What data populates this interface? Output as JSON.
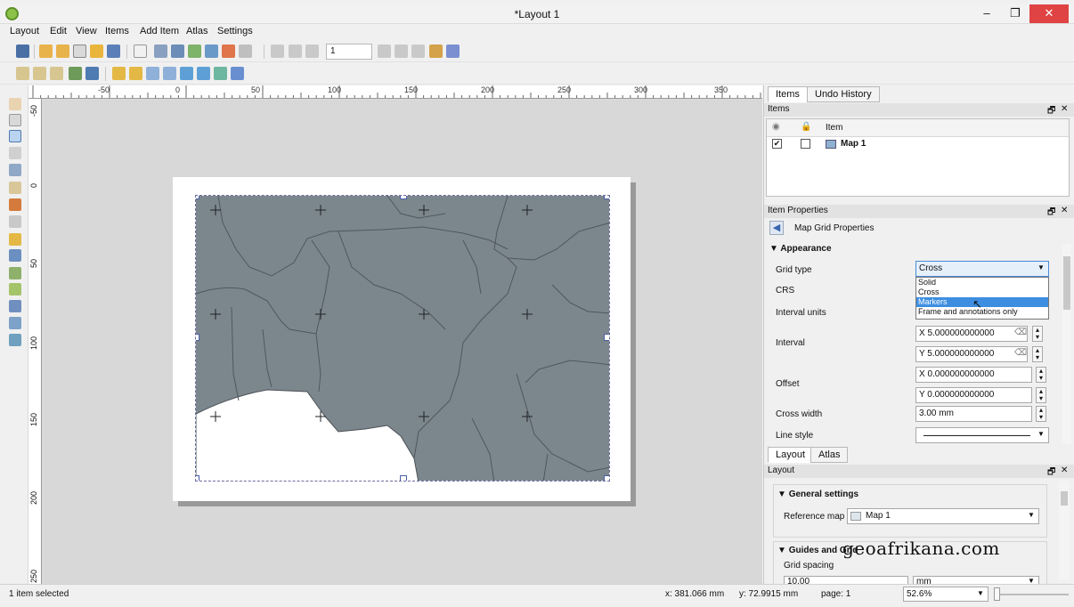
{
  "window": {
    "title": "*Layout 1",
    "min": "–",
    "max": "❐",
    "close": "✕"
  },
  "menu": [
    "Layout",
    "Edit",
    "View",
    "Items",
    "Add Item",
    "Atlas",
    "Settings"
  ],
  "toolbar": {
    "page_number": "1"
  },
  "ruler": {
    "top": [
      "-50",
      "0",
      "50",
      "100",
      "150",
      "200",
      "250",
      "300",
      "350"
    ],
    "left": [
      "-50",
      "0",
      "50",
      "100",
      "150",
      "200",
      "250"
    ]
  },
  "items_panel": {
    "tabs": [
      "Items",
      "Undo History"
    ],
    "header": "Items",
    "col_item": "Item",
    "rows": [
      {
        "name": "Map 1",
        "visible": true,
        "locked": false
      }
    ]
  },
  "item_props": {
    "header": "Item Properties",
    "subtitle": "Map Grid Properties",
    "section": "Appearance",
    "labels": {
      "grid_type": "Grid type",
      "crs": "CRS",
      "interval_units": "Interval units",
      "interval": "Interval",
      "offset": "Offset",
      "cross_width": "Cross width",
      "line_style": "Line style"
    },
    "grid_type_value": "Cross",
    "grid_type_options": [
      "Solid",
      "Cross",
      "Markers",
      "Frame and annotations only"
    ],
    "highlighted_option": "Markers",
    "interval_x": "X 5.000000000000",
    "interval_y": "Y 5.000000000000",
    "offset_x": "X 0.000000000000",
    "offset_y": "Y 0.000000000000",
    "cross_width": "3.00 mm"
  },
  "layout_panel": {
    "tabs": [
      "Layout",
      "Atlas"
    ],
    "header": "Layout",
    "general_settings": "General settings",
    "reference_map_label": "Reference map",
    "reference_map_value": "Map 1",
    "guides_grid": "Guides and Grid",
    "grid_spacing_label": "Grid spacing",
    "grid_spacing_value": "10.00",
    "grid_spacing_unit": "mm"
  },
  "status": {
    "message": "1 item selected",
    "x": "x: 381.066 mm",
    "y": "y: 72.9915 mm",
    "page": "page: 1",
    "zoom": "52.6%"
  },
  "watermark": "geoafrikana.com"
}
